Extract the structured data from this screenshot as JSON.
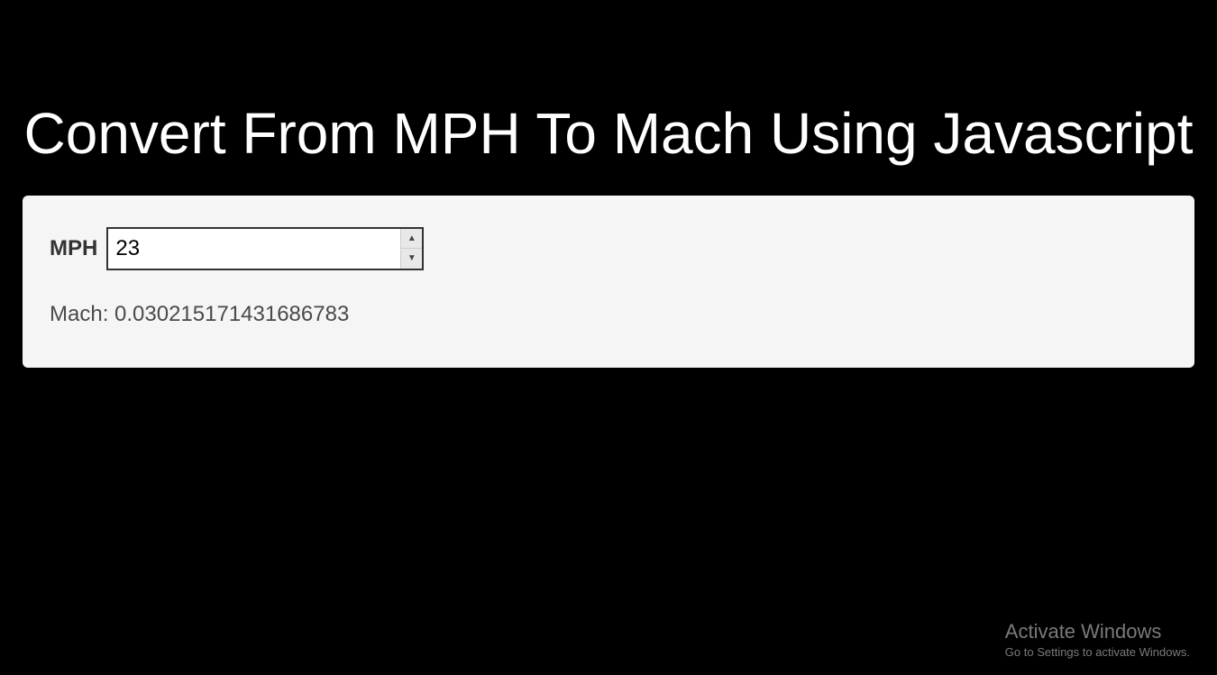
{
  "header": {
    "title": "Convert From MPH To Mach Using Javascript"
  },
  "form": {
    "input_label": "MPH",
    "input_value": "23"
  },
  "output": {
    "text": "Mach: 0.030215171431686783"
  },
  "watermark": {
    "title": "Activate Windows",
    "subtitle": "Go to Settings to activate Windows."
  }
}
